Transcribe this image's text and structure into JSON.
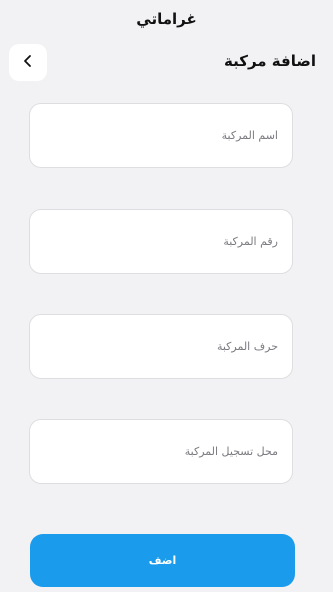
{
  "header": {
    "logo_text": "غراماتي",
    "title": "اضافة مركبة",
    "back_icon": "chevron-left-icon"
  },
  "form": {
    "vehicle_name": {
      "value": "",
      "placeholder": "اسم المركبة"
    },
    "vehicle_number": {
      "value": "",
      "placeholder": "رقم المركبة"
    },
    "vehicle_letter": {
      "value": "",
      "placeholder": "حرف المركبة"
    },
    "vehicle_registration_place": {
      "value": "",
      "placeholder": "محل تسجيل المركبة"
    },
    "submit_label": "اضف"
  },
  "colors": {
    "background": "#f2f2f4",
    "primary_button": "#1a9bec",
    "field_border": "#dedee2",
    "placeholder": "#7a7a80"
  }
}
